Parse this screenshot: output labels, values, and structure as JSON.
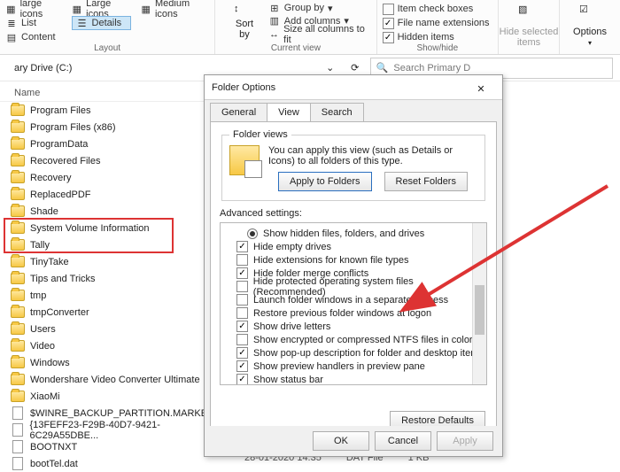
{
  "ribbon": {
    "layout_group_label": "Layout",
    "currentview_group_label": "Current view",
    "showhide_group_label": "Show/hide",
    "large_icons_brief": "large icons",
    "large_icons": "Large icons",
    "medium_icons": "Medium icons",
    "list": "List",
    "details": "Details",
    "content": "Content",
    "sort_by": "Sort\nby",
    "group_by": "Group by",
    "add_columns": "Add columns",
    "size_all": "Size all columns to fit",
    "item_checkboxes": "Item check boxes",
    "file_ext": "File name extensions",
    "hidden_items": "Hidden items",
    "hide_selected": "Hide selected\nitems",
    "options": "Options"
  },
  "address": {
    "breadcrumb": "ary Drive (C:)",
    "search_placeholder": "Search Primary D"
  },
  "columns": {
    "name": "Name"
  },
  "files": [
    {
      "t": "folder",
      "n": "Program Files"
    },
    {
      "t": "folder",
      "n": "Program Files (x86)"
    },
    {
      "t": "folder",
      "n": "ProgramData"
    },
    {
      "t": "folder",
      "n": "Recovered Files"
    },
    {
      "t": "folder",
      "n": "Recovery"
    },
    {
      "t": "folder",
      "n": "ReplacedPDF"
    },
    {
      "t": "folder",
      "n": "Shade"
    },
    {
      "t": "folder",
      "n": "System Volume Information"
    },
    {
      "t": "folder",
      "n": "Tally"
    },
    {
      "t": "folder",
      "n": "TinyTake"
    },
    {
      "t": "folder",
      "n": "Tips and Tricks"
    },
    {
      "t": "folder",
      "n": "tmp"
    },
    {
      "t": "folder",
      "n": "tmpConverter"
    },
    {
      "t": "folder",
      "n": "Users"
    },
    {
      "t": "folder",
      "n": "Video"
    },
    {
      "t": "folder",
      "n": "Windows"
    },
    {
      "t": "folder",
      "n": "Wondershare Video Converter Ultimate"
    },
    {
      "t": "folder",
      "n": "XiaoMi"
    },
    {
      "t": "file",
      "n": "$WINRE_BACKUP_PARTITION.MARKER"
    },
    {
      "t": "file",
      "n": "{13FEFF23-F29B-40D7-9421-6C29A55DBE..."
    },
    {
      "t": "file",
      "n": "BOOTNXT"
    },
    {
      "t": "file",
      "n": "bootTel.dat"
    }
  ],
  "peek": {
    "date": "28-01-2020 14:35",
    "type": "DAT File",
    "size": "1 KB"
  },
  "dialog": {
    "title": "Folder Options",
    "tabs": {
      "general": "General",
      "view": "View",
      "search": "Search"
    },
    "folder_views_legend": "Folder views",
    "folder_views_text": "You can apply this view (such as Details or Icons) to all folders of this type.",
    "apply_to_folders": "Apply to Folders",
    "reset_folders": "Reset Folders",
    "advanced_label": "Advanced settings:",
    "restore_defaults": "Restore Defaults",
    "ok": "OK",
    "cancel": "Cancel",
    "apply": "Apply",
    "adv": [
      {
        "kind": "radio",
        "checked": true,
        "label": "Show hidden files, folders, and drives",
        "lvl": 2
      },
      {
        "kind": "check",
        "checked": true,
        "label": "Hide empty drives"
      },
      {
        "kind": "check",
        "checked": false,
        "label": "Hide extensions for known file types"
      },
      {
        "kind": "check",
        "checked": true,
        "label": "Hide folder merge conflicts"
      },
      {
        "kind": "check",
        "checked": false,
        "label": "Hide protected operating system files (Recommended)"
      },
      {
        "kind": "check",
        "checked": false,
        "label": "Launch folder windows in a separate process"
      },
      {
        "kind": "check",
        "checked": false,
        "label": "Restore previous folder windows at logon"
      },
      {
        "kind": "check",
        "checked": true,
        "label": "Show drive letters"
      },
      {
        "kind": "check",
        "checked": false,
        "label": "Show encrypted or compressed NTFS files in color"
      },
      {
        "kind": "check",
        "checked": true,
        "label": "Show pop-up description for folder and desktop items"
      },
      {
        "kind": "check",
        "checked": true,
        "label": "Show preview handlers in preview pane"
      },
      {
        "kind": "check",
        "checked": true,
        "label": "Show status bar"
      }
    ]
  }
}
